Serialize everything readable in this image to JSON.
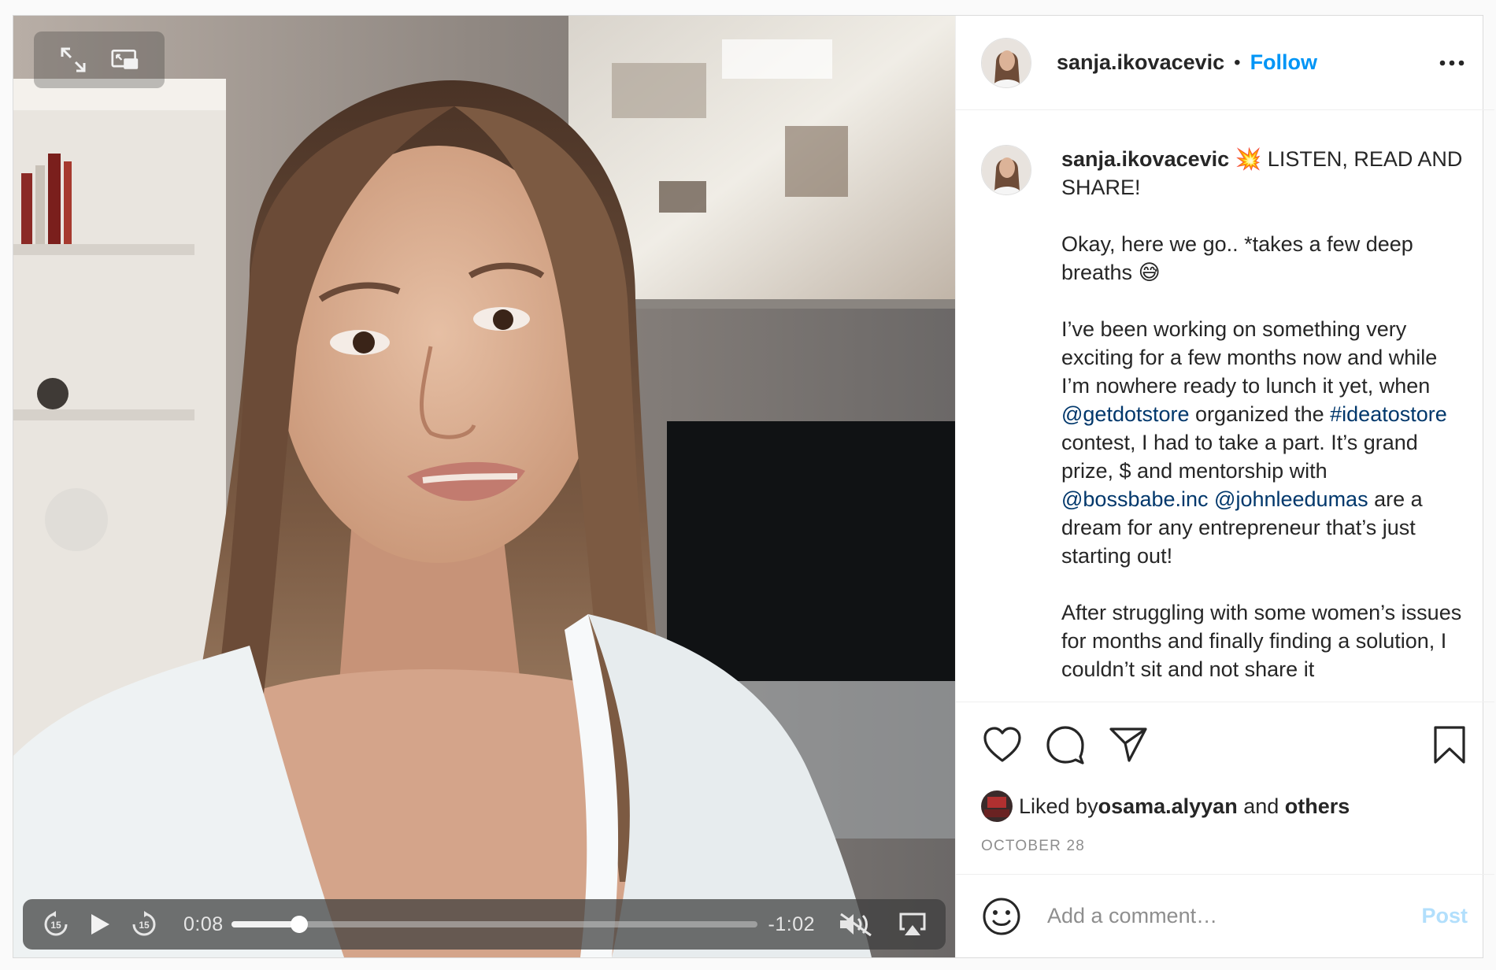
{
  "colors": {
    "accent": "#0095f6",
    "link": "#00376b",
    "post_disabled": "#b2dffc",
    "muted": "#8e8e8e"
  },
  "header": {
    "username": "sanja.ikovacevic",
    "separator": "•",
    "follow_label": "Follow",
    "more_icon": "more-horizontal-icon"
  },
  "video": {
    "current_time": "0:08",
    "remaining_time": "-1:02",
    "progress": 0.13,
    "icons": [
      "expand-icon",
      "picture-in-picture-icon",
      "rewind-15-icon",
      "play-icon",
      "forward-15-icon",
      "mute-icon",
      "airplay-icon"
    ]
  },
  "caption": {
    "username": "sanja.ikovacevic",
    "emoji_1": "💥",
    "p1_text": " LISTEN, READ AND SHARE!",
    "p2_text": "Okay, here we go.. *takes a few deep breaths ",
    "emoji_2": "😅",
    "p3_a": "I’ve been working on something very exciting for a few months now and while I’m nowhere ready to lunch it yet, when ",
    "mention_1": "@getdotstore",
    "p3_b": " organized the ",
    "hashtag_1": "#ideatostore",
    "p3_c": " contest, I had to take a part. It’s grand prize, $ and mentorship with ",
    "mention_2": "@bossbabe.inc",
    "p3_d": " ",
    "mention_3": "@johnleedumas",
    "p3_e": " are a dream for any entrepreneur that’s just starting out!",
    "p4_text": "After struggling with some women’s issues for months and finally finding a solution, I couldn’t sit and not share it"
  },
  "actions": {
    "icons": [
      "heart-icon",
      "comment-icon",
      "share-icon",
      "bookmark-icon"
    ]
  },
  "likes": {
    "prefix": "Liked by ",
    "user": "osama.alyyan",
    "middle": " and ",
    "others": "others"
  },
  "date": "OCTOBER 28",
  "comment": {
    "placeholder": "Add a comment…",
    "post_label": "Post",
    "emoji_icon": "smiley-icon"
  }
}
